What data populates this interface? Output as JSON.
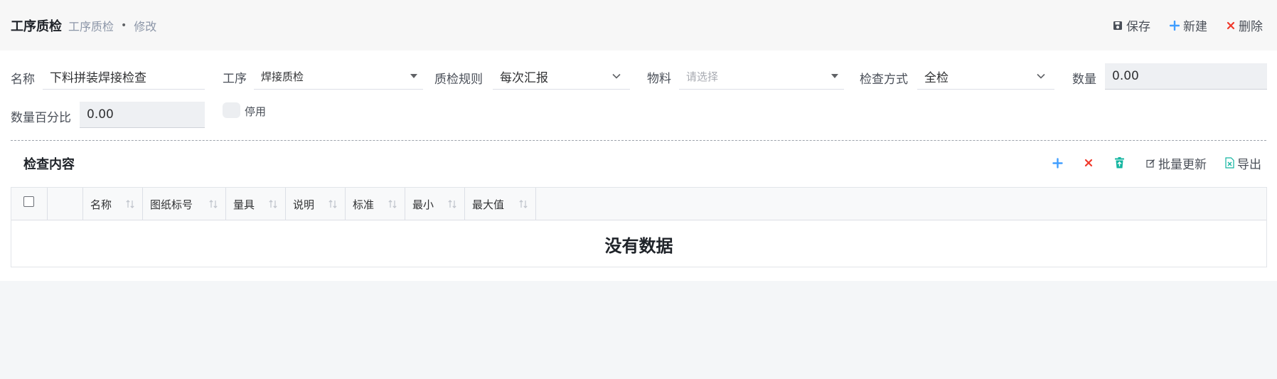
{
  "header": {
    "title": "工序质检",
    "breadcrumb": [
      "工序质检",
      "修改"
    ],
    "separator": "•"
  },
  "toolbar": {
    "save_label": "保存",
    "new_label": "新建",
    "delete_label": "删除"
  },
  "form": {
    "name_label": "名称",
    "name_value": "下料拼装焊接检查",
    "process_label": "工序",
    "process_value": "焊接质检",
    "rule_label": "质检规则",
    "rule_value": "每次汇报",
    "material_label": "物料",
    "material_placeholder": "请选择",
    "method_label": "检查方式",
    "method_value": "全检",
    "qty_label": "数量",
    "qty_value": "0.00",
    "pct_label": "数量百分比",
    "pct_value": "0.00",
    "disable_label": "停用"
  },
  "section": {
    "title": "检查内容",
    "batch_update_label": "批量更新",
    "export_label": "导出"
  },
  "table": {
    "columns": [
      "名称",
      "图纸标号",
      "量具",
      "说明",
      "标准",
      "最小",
      "最大值"
    ],
    "empty_text": "没有数据"
  },
  "colors": {
    "accent_blue": "#409eff",
    "danger_red": "#f56c6c",
    "teal": "#13b5a0"
  }
}
